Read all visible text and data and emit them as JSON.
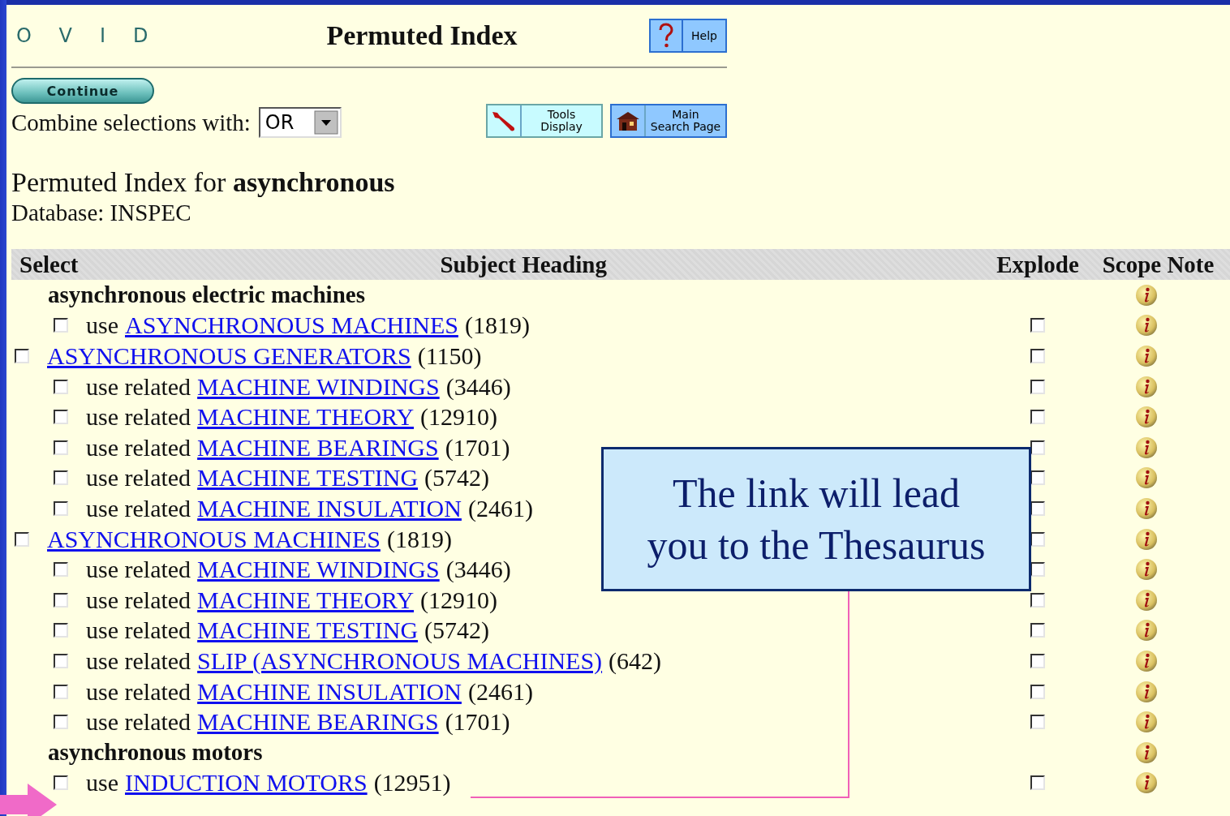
{
  "logo": "OVID",
  "title": "Permuted Index",
  "help_button": "Help",
  "continue_button": "Continue",
  "combine": {
    "label": "Combine selections with:",
    "value": "OR"
  },
  "nav_buttons": [
    {
      "kind": "tools",
      "lines": [
        "Tools",
        "Display"
      ]
    },
    {
      "kind": "home",
      "lines": [
        "Main",
        "Search Page"
      ]
    }
  ],
  "results_heading": "Permuted Index for **asynchronous**",
  "database": "Database: INSPEC",
  "table": {
    "columns": [
      "Select",
      "Subject Heading",
      "Explode",
      "Scope Note"
    ],
    "rows": [
      {
        "kind": "heading",
        "text": "asynchronous electric machines"
      },
      {
        "kind": "use",
        "prefix": "use",
        "link": "ASYNCHRONOUS MACHINES",
        "count": "(1819)",
        "select_checked": false,
        "explode_checked": false
      },
      {
        "kind": "main",
        "link": "ASYNCHRONOUS GENERATORS",
        "count": "(1150)",
        "select_checked": false,
        "explode_checked": false
      },
      {
        "kind": "use",
        "prefix": "use related",
        "link": "MACHINE WINDINGS",
        "count": "(3446)",
        "select_checked": false,
        "explode_checked": false
      },
      {
        "kind": "use",
        "prefix": "use related",
        "link": "MACHINE THEORY",
        "count": "(12910)",
        "select_checked": false,
        "explode_checked": false
      },
      {
        "kind": "use",
        "prefix": "use related",
        "link": "MACHINE BEARINGS",
        "count": "(1701)",
        "select_checked": false,
        "explode_checked": false
      },
      {
        "kind": "use",
        "prefix": "use related",
        "link": "MACHINE TESTING",
        "count": "(5742)",
        "select_checked": false,
        "explode_checked": false
      },
      {
        "kind": "use",
        "prefix": "use related",
        "link": "MACHINE INSULATION",
        "count": "(2461)",
        "select_checked": false,
        "explode_checked": false
      },
      {
        "kind": "main",
        "link": "ASYNCHRONOUS MACHINES",
        "count": "(1819)",
        "select_checked": false,
        "explode_checked": false
      },
      {
        "kind": "use",
        "prefix": "use related",
        "link": "MACHINE WINDINGS",
        "count": "(3446)",
        "select_checked": false,
        "explode_checked": false
      },
      {
        "kind": "use",
        "prefix": "use related",
        "link": "MACHINE THEORY",
        "count": "(12910)",
        "select_checked": false,
        "explode_checked": false
      },
      {
        "kind": "use",
        "prefix": "use related",
        "link": "MACHINE TESTING",
        "count": "(5742)",
        "select_checked": false,
        "explode_checked": false
      },
      {
        "kind": "use",
        "prefix": "use related",
        "link": "SLIP (ASYNCHRONOUS MACHINES)",
        "count": "(642)",
        "select_checked": false,
        "explode_checked": false
      },
      {
        "kind": "use",
        "prefix": "use related",
        "link": "MACHINE INSULATION",
        "count": "(2461)",
        "select_checked": false,
        "explode_checked": false
      },
      {
        "kind": "use",
        "prefix": "use related",
        "link": "MACHINE BEARINGS",
        "count": "(1701)",
        "select_checked": false,
        "explode_checked": false
      },
      {
        "kind": "heading",
        "text": "asynchronous motors"
      },
      {
        "kind": "use",
        "prefix": "use",
        "link": "INDUCTION MOTORS",
        "count": "(12951)",
        "select_checked": false,
        "explode_checked": false
      }
    ]
  },
  "callout": {
    "lines": [
      "The link will lead",
      "you to the Thesaurus"
    ]
  }
}
